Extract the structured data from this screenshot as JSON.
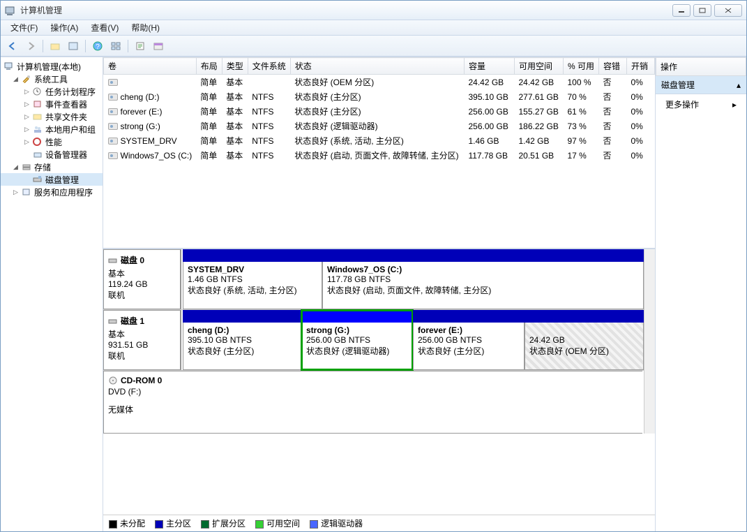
{
  "window": {
    "title": "计算机管理"
  },
  "menu": {
    "file": "文件(F)",
    "action": "操作(A)",
    "view": "查看(V)",
    "help": "帮助(H)"
  },
  "tree": {
    "root": "计算机管理(本地)",
    "system_tools": "系统工具",
    "task_scheduler": "任务计划程序",
    "event_viewer": "事件查看器",
    "shared_folders": "共享文件夹",
    "local_users": "本地用户和组",
    "performance": "性能",
    "device_manager": "设备管理器",
    "storage": "存储",
    "disk_management": "磁盘管理",
    "services_apps": "服务和应用程序"
  },
  "columns": {
    "volume": "卷",
    "layout": "布局",
    "type": "类型",
    "filesystem": "文件系统",
    "status": "状态",
    "capacity": "容量",
    "free": "可用空间",
    "pct_free": "% 可用",
    "fault": "容错",
    "overhead": "开销"
  },
  "volumes": [
    {
      "name": "",
      "layout": "简单",
      "type": "基本",
      "fs": "",
      "status": "状态良好 (OEM 分区)",
      "capacity": "24.42 GB",
      "free": "24.42 GB",
      "pct": "100 %",
      "fault": "否",
      "overhead": "0%"
    },
    {
      "name": "cheng (D:)",
      "layout": "简单",
      "type": "基本",
      "fs": "NTFS",
      "status": "状态良好 (主分区)",
      "capacity": "395.10 GB",
      "free": "277.61 GB",
      "pct": "70 %",
      "fault": "否",
      "overhead": "0%"
    },
    {
      "name": "forever (E:)",
      "layout": "简单",
      "type": "基本",
      "fs": "NTFS",
      "status": "状态良好 (主分区)",
      "capacity": "256.00 GB",
      "free": "155.27 GB",
      "pct": "61 %",
      "fault": "否",
      "overhead": "0%"
    },
    {
      "name": "strong (G:)",
      "layout": "简单",
      "type": "基本",
      "fs": "NTFS",
      "status": "状态良好 (逻辑驱动器)",
      "capacity": "256.00 GB",
      "free": "186.22 GB",
      "pct": "73 %",
      "fault": "否",
      "overhead": "0%"
    },
    {
      "name": "SYSTEM_DRV",
      "layout": "简单",
      "type": "基本",
      "fs": "NTFS",
      "status": "状态良好 (系统, 活动, 主分区)",
      "capacity": "1.46 GB",
      "free": "1.42 GB",
      "pct": "97 %",
      "fault": "否",
      "overhead": "0%"
    },
    {
      "name": "Windows7_OS (C:)",
      "layout": "简单",
      "type": "基本",
      "fs": "NTFS",
      "status": "状态良好 (启动, 页面文件, 故障转储, 主分区)",
      "capacity": "117.78 GB",
      "free": "20.51 GB",
      "pct": "17 %",
      "fault": "否",
      "overhead": "0%"
    }
  ],
  "disks": {
    "disk0": {
      "label": "磁盘 0",
      "type": "基本",
      "size": "119.24 GB",
      "status": "联机",
      "parts": [
        {
          "title": "SYSTEM_DRV",
          "line2": "1.46 GB NTFS",
          "line3": "状态良好 (系统, 活动, 主分区)"
        },
        {
          "title": "Windows7_OS   (C:)",
          "line2": "117.78 GB NTFS",
          "line3": "状态良好 (启动, 页面文件, 故障转储, 主分区)"
        }
      ]
    },
    "disk1": {
      "label": "磁盘 1",
      "type": "基本",
      "size": "931.51 GB",
      "status": "联机",
      "parts": [
        {
          "title": "cheng   (D:)",
          "line2": "395.10 GB NTFS",
          "line3": "状态良好 (主分区)"
        },
        {
          "title": "strong   (G:)",
          "line2": "256.00 GB NTFS",
          "line3": "状态良好 (逻辑驱动器)"
        },
        {
          "title": "forever   (E:)",
          "line2": "256.00 GB NTFS",
          "line3": "状态良好 (主分区)"
        },
        {
          "title": "",
          "line2": "24.42 GB",
          "line3": "状态良好 (OEM 分区)"
        }
      ]
    },
    "cdrom": {
      "label": "CD-ROM 0",
      "line2": "DVD (F:)",
      "line3": "无媒体"
    }
  },
  "legend": {
    "unalloc": "未分配",
    "primary": "主分区",
    "extended": "扩展分区",
    "free": "可用空间",
    "logical": "逻辑驱动器"
  },
  "actions": {
    "header": "操作",
    "disk_mgmt": "磁盘管理",
    "more": "更多操作"
  }
}
